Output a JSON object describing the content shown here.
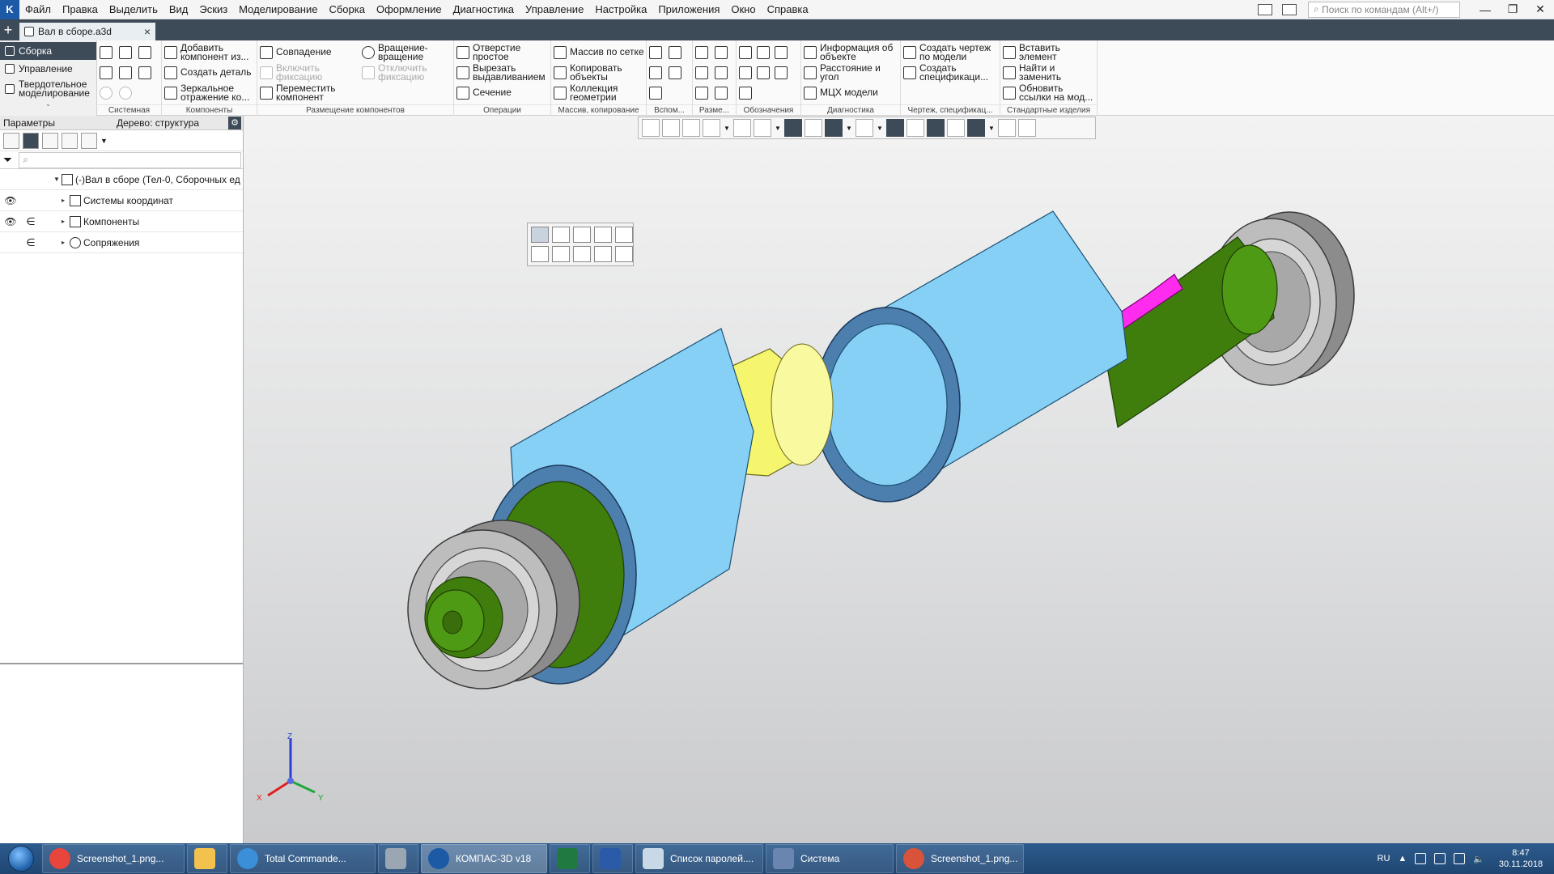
{
  "menu": [
    "Файл",
    "Правка",
    "Выделить",
    "Вид",
    "Эскиз",
    "Моделирование",
    "Сборка",
    "Оформление",
    "Диагностика",
    "Управление",
    "Настройка",
    "Приложения",
    "Окно",
    "Справка"
  ],
  "search": {
    "placeholder": "Поиск по командам (Alt+/)"
  },
  "document_tab": {
    "title": "Вал в сборе.a3d",
    "close": "×"
  },
  "modes": [
    "Сборка",
    "Управление",
    "Твердотельное моделирование"
  ],
  "ribbon": {
    "groups": [
      {
        "name": "Системная"
      },
      {
        "name": "Компоненты",
        "items": [
          "Добавить компонент из...",
          "Создать деталь",
          "Зеркальное отражение ко..."
        ]
      },
      {
        "name": "Размещение компонентов",
        "items": [
          "Совпадение",
          "Включить фиксацию",
          "Переместить компонент",
          "Вращение-вращение",
          "Отключить фиксацию"
        ]
      },
      {
        "name": "Операции",
        "items": [
          "Отверстие простое",
          "Вырезать выдавливанием",
          "Сечение"
        ]
      },
      {
        "name": "Массив, копирование",
        "items": [
          "Массив по сетке",
          "Копировать объекты",
          "Коллекция геометрии"
        ]
      },
      {
        "name": "Вспом..."
      },
      {
        "name": "Разме..."
      },
      {
        "name": "Обозначения"
      },
      {
        "name": "Диагностика",
        "items": [
          "Информация об объекте",
          "Расстояние и угол",
          "МЦХ модели"
        ]
      },
      {
        "name": "Чертеж, спецификац...",
        "items": [
          "Создать чертеж по модели",
          "Создать спецификаци..."
        ]
      },
      {
        "name": "Стандартные изделия",
        "items": [
          "Вставить элемент",
          "Найти и заменить",
          "Обновить ссылки на мод..."
        ]
      }
    ]
  },
  "left_panel": {
    "tab_params": "Параметры",
    "tab_tree": "Дерево: структура",
    "filter_placeholder": "⌕",
    "tree": [
      {
        "label": "(-)Вал в сборе (Тел-0, Сборочных ед",
        "visible": false,
        "included": false
      },
      {
        "label": "Системы координат",
        "visible": true,
        "included": false
      },
      {
        "label": "Компоненты",
        "visible": true,
        "included": true
      },
      {
        "label": "Сопряжения",
        "visible": false,
        "included": true
      }
    ]
  },
  "axes": {
    "z": "Z",
    "x": "X",
    "y": "Y"
  },
  "taskbar": {
    "tasks": [
      {
        "label": "Screenshot_1.png...",
        "icon": "chrome-icon",
        "color": "#e8453c"
      },
      {
        "label": "",
        "icon": "explorer-icon",
        "color": "#f2c14e"
      },
      {
        "label": "Total Commande...",
        "icon": "total-commander-icon",
        "color": "#3b8ed8"
      },
      {
        "label": "",
        "icon": "calculator-icon",
        "color": "#9aa6b2"
      },
      {
        "label": "КОМПАС-3D v18",
        "icon": "kompas-icon",
        "color": "#1c5aa6"
      },
      {
        "label": "",
        "icon": "excel-icon",
        "color": "#1f7a3f"
      },
      {
        "label": "",
        "icon": "word-icon",
        "color": "#2a5aa8"
      },
      {
        "label": "Список паролей....",
        "icon": "notepad-icon",
        "color": "#c9d8e6"
      },
      {
        "label": "Система",
        "icon": "system-icon",
        "color": "#6a86b0"
      },
      {
        "label": "Screenshot_1.png...",
        "icon": "viewer-icon",
        "color": "#d9533b"
      }
    ],
    "lang": "RU",
    "time": "8:47",
    "date": "30.11.2018"
  },
  "colors": {
    "accent": "#3d4a58",
    "gear": "#87d0f5",
    "shaft": "#3f7d0c",
    "spacer": "#f5f56e",
    "key": "#ff2cf0",
    "bearing": "#bdbdbd"
  }
}
